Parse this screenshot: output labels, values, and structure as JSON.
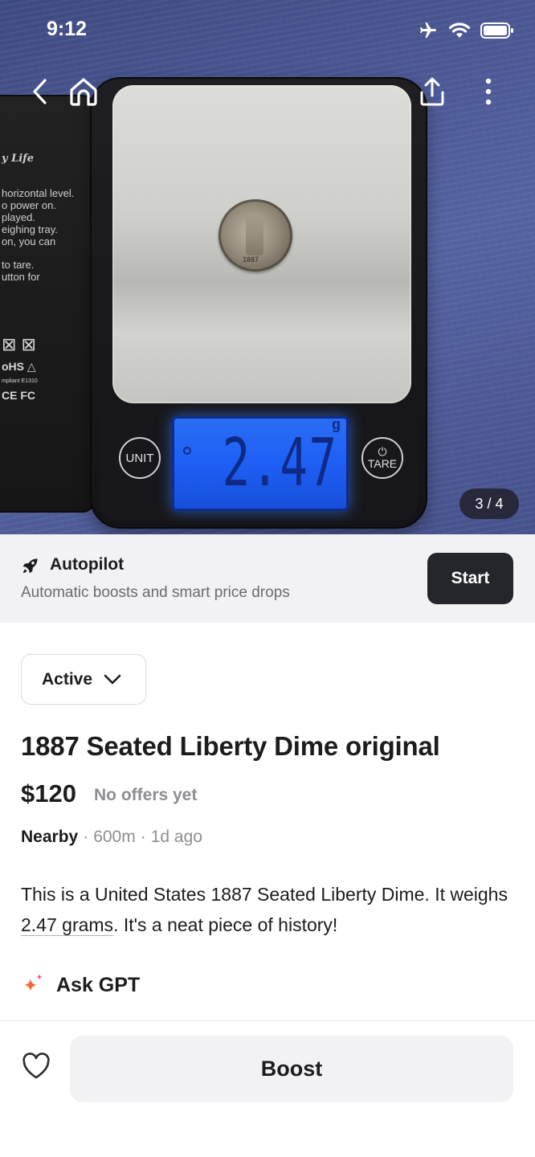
{
  "status_bar": {
    "time": "9:12"
  },
  "photo": {
    "counter": "3 / 4",
    "scale_reading": "2.47",
    "scale_unit": "g",
    "unit_button": "UNIT",
    "tare_button": "TARE",
    "manual_lines": [
      "y Life",
      "horizontal level.",
      "o power on.",
      "played.",
      "eighing tray.",
      "on,  you can",
      "to tare.",
      "utton for"
    ],
    "manual_marks": {
      "rohs": "oHS",
      "compliant": "mpliant   E1310",
      "ce": "CE FC"
    },
    "coin_year": "1887"
  },
  "autopilot": {
    "title": "Autopilot",
    "subtitle": "Automatic boosts and smart price drops",
    "start_label": "Start"
  },
  "listing": {
    "status": "Active",
    "title": "1887 Seated Liberty Dime original",
    "price": "$120",
    "offers": "No offers yet",
    "location": "Nearby",
    "distance": "600m",
    "posted": "1d ago",
    "description_pre": "This is a United States 1887 Seated Liberty Dime. It weighs ",
    "description_highlight": "2.47 grams",
    "description_post": ". It's a neat piece of history!",
    "ask_gpt": "Ask GPT"
  },
  "bottom_bar": {
    "boost_label": "Boost"
  },
  "colors": {
    "dark_button": "#24262b",
    "banner_bg": "#f2f2f4",
    "muted_text": "#8e8e93",
    "gpt_orange": "#f46a35",
    "gpt_pink": "#e25c9a"
  },
  "icons": {
    "back": "chevron-left-icon",
    "home": "home-icon",
    "share": "share-icon",
    "more": "more-vertical-icon",
    "autopilot": "rocket-icon",
    "dropdown": "chevron-down-icon",
    "ask_gpt": "sparkle-icon",
    "favorite": "heart-icon"
  }
}
